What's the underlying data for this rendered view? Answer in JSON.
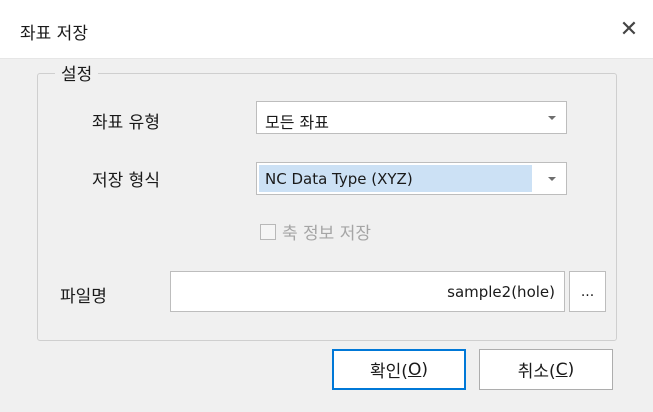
{
  "window": {
    "title": "좌표 저장",
    "close_icon": "close-icon"
  },
  "group": {
    "title": "설정"
  },
  "coord_type": {
    "label": "좌표 유형",
    "value": "모든 좌표"
  },
  "save_format": {
    "label": "저장 형식",
    "value": "NC Data Type (XYZ)"
  },
  "axis_info": {
    "label": "축 정보 저장",
    "checked": false,
    "enabled": false
  },
  "filename": {
    "label": "파일명",
    "value": "sample2(hole)",
    "browse_label": "..."
  },
  "buttons": {
    "ok_prefix": "확인(",
    "ok_mnemonic": "O",
    "ok_suffix": ")",
    "cancel_prefix": "취소(",
    "cancel_mnemonic": "C",
    "cancel_suffix": ")"
  },
  "colors": {
    "focus_border": "#0078d7",
    "selection": "#cce1f5",
    "disabled_text": "#a5a5a5"
  }
}
